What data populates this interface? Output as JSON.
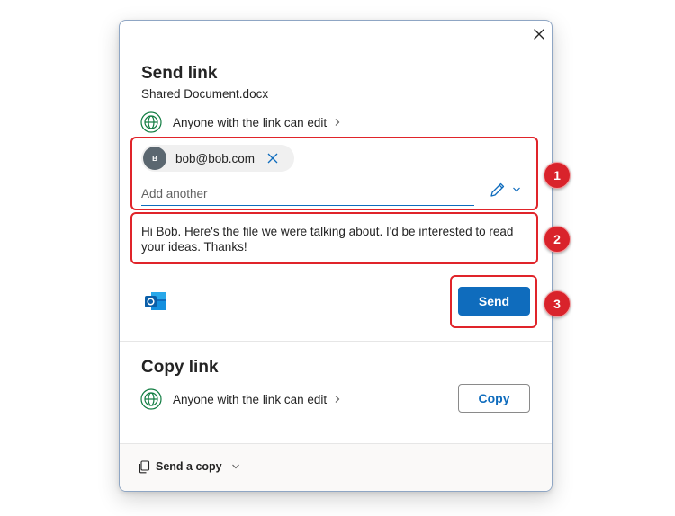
{
  "dialog": {
    "send_section": {
      "title": "Send link",
      "document_name": "Shared Document.docx",
      "permission": "Anyone with the link can edit",
      "recipient": {
        "avatar_initial": "B",
        "email": "bob@bob.com"
      },
      "add_placeholder": "Add another",
      "message": "Hi Bob. Here's the file we were talking about. I'd be interested to read your ideas. Thanks!",
      "send_label": "Send"
    },
    "copy_section": {
      "title": "Copy link",
      "permission": "Anyone with the link can edit",
      "copy_label": "Copy"
    },
    "footer": {
      "send_copy_label": "Send a copy"
    },
    "icons": [
      "close-icon",
      "globe-icon",
      "chevron-right-icon",
      "remove-recipient-icon",
      "pencil-icon",
      "chevron-down-icon",
      "outlook-icon",
      "copy-document-icon"
    ]
  },
  "annotations": {
    "labels": [
      "1",
      "2",
      "3"
    ],
    "color": "#d9232b"
  },
  "colors": {
    "accent": "#0f6cbd",
    "globe": "#107c41",
    "annotation": "#e0242a"
  }
}
